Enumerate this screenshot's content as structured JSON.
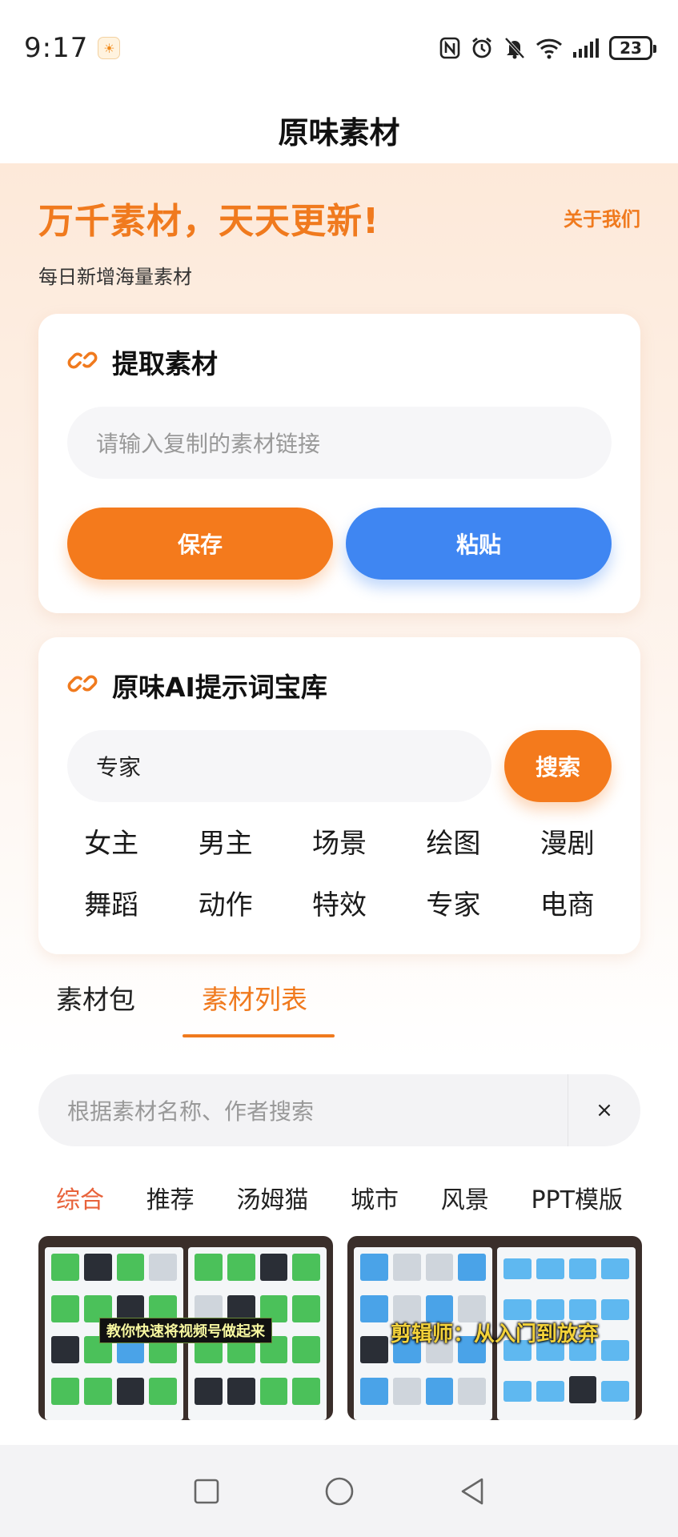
{
  "status_bar": {
    "time": "9:17",
    "battery": "23",
    "app_badge_icon": "app-notification-icon",
    "icons": [
      "nfc-icon",
      "alarm-icon",
      "mute-icon",
      "wifi-icon",
      "signal-icon"
    ]
  },
  "header": {
    "title": "原味素材"
  },
  "hero": {
    "title": "万千素材，天天更新!",
    "about": "关于我们",
    "subtitle": "每日新增海量素材"
  },
  "extract_card": {
    "title": "提取素材",
    "input_placeholder": "请输入复制的素材链接",
    "save_label": "保存",
    "paste_label": "粘贴"
  },
  "ai_card": {
    "title": "原味AI提示词宝库",
    "search_value": "专家",
    "search_label": "搜索",
    "tags": [
      "女主",
      "男主",
      "场景",
      "绘图",
      "漫剧",
      "舞蹈",
      "动作",
      "特效",
      "专家",
      "电商"
    ]
  },
  "tabs": {
    "items": [
      "素材包",
      "素材列表"
    ],
    "active_index": 1
  },
  "list_search": {
    "placeholder": "根据素材名称、作者搜索",
    "clear_label": "×"
  },
  "categories": {
    "items": [
      "综合",
      "推荐",
      "汤姆猫",
      "城市",
      "风景",
      "PPT模版"
    ],
    "active_index": 0
  },
  "thumbnails": [
    {
      "caption": "教你快速将视频号做起来"
    },
    {
      "caption": "剪辑师：从入门到放弃"
    }
  ],
  "colors": {
    "accent_orange": "#f47a1c",
    "accent_blue": "#3f86f2",
    "active_category": "#e8623a"
  }
}
